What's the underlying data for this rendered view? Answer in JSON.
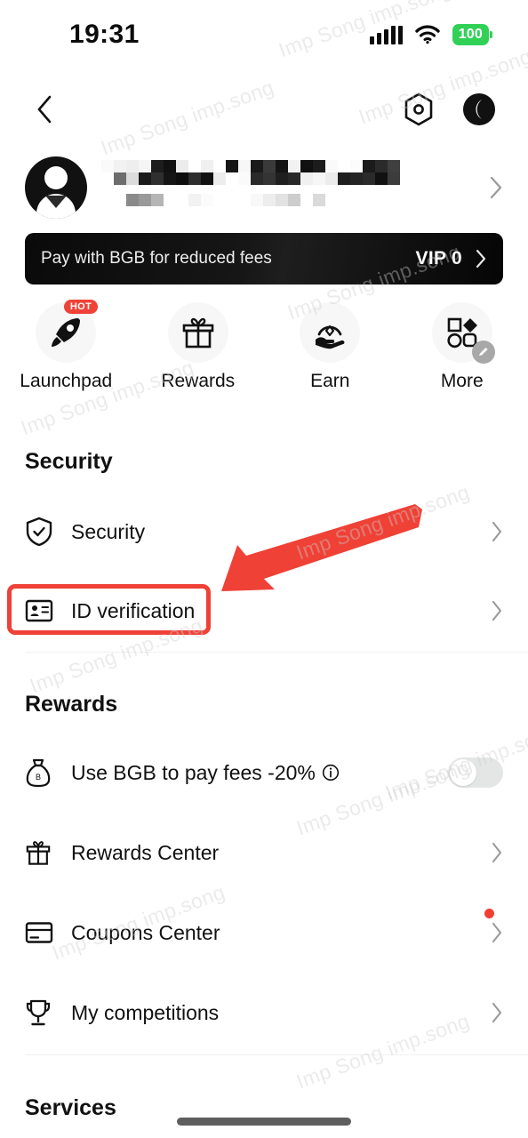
{
  "status_bar": {
    "time": "19:31",
    "battery_level": "100",
    "battery_color": "#31d158",
    "signal_icon": "signal-bars-icon",
    "wifi_icon": "wifi-icon"
  },
  "nav_bar": {
    "back_icon": "chevron-left-icon",
    "settings_icon": "hex-gear-icon",
    "theme_icon": "moon-icon"
  },
  "profile": {
    "name_redacted": true,
    "avatar_icon": "user-avatar-icon",
    "chevron_icon": "chevron-right-icon"
  },
  "vip_banner": {
    "text": "Pay with BGB for reduced fees",
    "level": "VIP 0",
    "chevron_icon": "chevron-right-icon",
    "background": "#0a0a0a"
  },
  "quick_actions": [
    {
      "label": "Launchpad",
      "icon": "rocket-icon",
      "badge": "HOT",
      "badge_color": "#f04238"
    },
    {
      "label": "Rewards",
      "icon": "gift-icon",
      "badge": "",
      "badge_color": ""
    },
    {
      "label": "Earn",
      "icon": "hand-coin-icon",
      "badge": "",
      "badge_color": ""
    },
    {
      "label": "More",
      "icon": "grid-shapes-icon",
      "badge": "",
      "badge_color": ""
    }
  ],
  "sections": {
    "security": {
      "title": "Security",
      "rows": [
        {
          "label": "Security",
          "icon": "shield-check-icon",
          "chevron": "chevron-right-icon",
          "dot": false
        },
        {
          "label": "ID verification",
          "icon": "id-card-icon",
          "chevron": "chevron-right-icon",
          "dot": false
        }
      ]
    },
    "rewards": {
      "title": "Rewards",
      "toggle_row": {
        "label": "Use BGB to pay fees -20%",
        "icon": "money-bag-icon",
        "info_icon": "info-icon",
        "toggle_state": "off"
      },
      "rows": [
        {
          "label": "Rewards Center",
          "icon": "gift-icon",
          "chevron": "chevron-right-icon",
          "dot": false
        },
        {
          "label": "Coupons Center",
          "icon": "coupon-card-icon",
          "chevron": "chevron-right-icon",
          "dot": true
        },
        {
          "label": "My competitions",
          "icon": "trophy-icon",
          "chevron": "chevron-right-icon",
          "dot": false
        }
      ]
    },
    "services": {
      "title": "Services"
    }
  },
  "annotation": {
    "highlight_target": "ID verification",
    "highlight_color": "#ef4136",
    "arrow_color": "#ef4136"
  },
  "watermark": {
    "text": "Imp Song imp.song",
    "color": "#cfcfcf"
  }
}
